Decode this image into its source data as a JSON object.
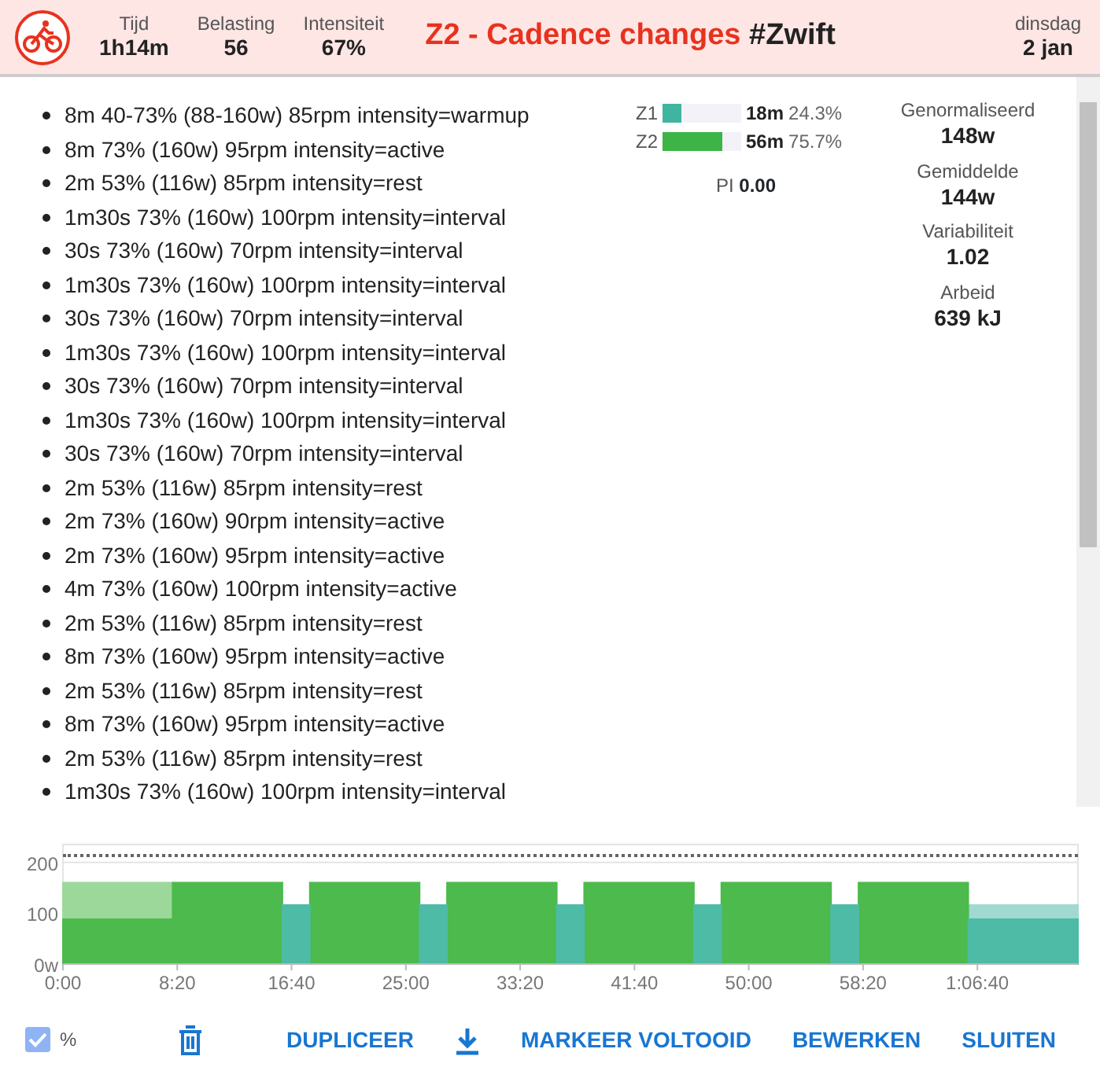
{
  "header": {
    "stats": [
      {
        "label": "Tijd",
        "value": "1h14m"
      },
      {
        "label": "Belasting",
        "value": "56"
      },
      {
        "label": "Intensiteit",
        "value": "67%"
      }
    ],
    "title": "Z2 - Cadence changes",
    "tag": "#Zwift",
    "day": "dinsdag",
    "date": "2 jan"
  },
  "steps": [
    "8m 40-73% (88-160w) 85rpm intensity=warmup",
    "8m 73% (160w) 95rpm intensity=active",
    "2m 53% (116w) 85rpm intensity=rest",
    "1m30s 73% (160w) 100rpm intensity=interval",
    "30s 73% (160w) 70rpm intensity=interval",
    "1m30s 73% (160w) 100rpm intensity=interval",
    "30s 73% (160w) 70rpm intensity=interval",
    "1m30s 73% (160w) 100rpm intensity=interval",
    "30s 73% (160w) 70rpm intensity=interval",
    "1m30s 73% (160w) 100rpm intensity=interval",
    "30s 73% (160w) 70rpm intensity=interval",
    "2m 53% (116w) 85rpm intensity=rest",
    "2m 73% (160w) 90rpm intensity=active",
    "2m 73% (160w) 95rpm intensity=active",
    "4m 73% (160w) 100rpm intensity=active",
    "2m 53% (116w) 85rpm intensity=rest",
    "8m 73% (160w) 95rpm intensity=active",
    "2m 53% (116w) 85rpm intensity=rest",
    "8m 73% (160w) 95rpm intensity=active",
    "2m 53% (116w) 85rpm intensity=rest",
    "1m30s 73% (160w) 100rpm intensity=interval"
  ],
  "zones": [
    {
      "name": "Z1",
      "color": "#3fb5a0",
      "level": 0.243,
      "time": "18m",
      "percent": "24.3%"
    },
    {
      "name": "Z2",
      "color": "#3cb446",
      "level": 0.757,
      "time": "56m",
      "percent": "75.7%"
    }
  ],
  "pi": {
    "label": "PI",
    "value": "0.00"
  },
  "metrics": [
    {
      "label": "Genormaliseerd",
      "value": "148w"
    },
    {
      "label": "Gemiddelde",
      "value": "144w"
    },
    {
      "label": "Variabiliteit",
      "value": "1.02"
    },
    {
      "label": "Arbeid",
      "value": "639 kJ"
    }
  ],
  "chart_data": {
    "type": "area",
    "x": [
      0,
      480,
      480,
      960,
      960,
      1080,
      1080,
      1560,
      1560,
      1680,
      1680,
      2160,
      2160,
      2280,
      2280,
      2760,
      2760,
      2880,
      2880,
      3360,
      3360,
      3480,
      3480,
      3960,
      3960,
      4440
    ],
    "xlim": [
      0,
      4440
    ],
    "ylim": [
      0,
      235
    ],
    "xticks": [
      {
        "value": 0,
        "label": "0:00"
      },
      {
        "value": 500,
        "label": "8:20"
      },
      {
        "value": 1000,
        "label": "16:40"
      },
      {
        "value": 1500,
        "label": "25:00"
      },
      {
        "value": 2000,
        "label": "33:20"
      },
      {
        "value": 2500,
        "label": "41:40"
      },
      {
        "value": 3000,
        "label": "50:00"
      },
      {
        "value": 3500,
        "label": "58:20"
      },
      {
        "value": 4000,
        "label": "1:06:40"
      }
    ],
    "yticks": [
      {
        "value": 0,
        "label": "0w"
      },
      {
        "value": 100,
        "label": "100"
      },
      {
        "value": 200,
        "label": "200"
      }
    ],
    "series": [
      {
        "color": "#9cd89a",
        "values": [
          160,
          160,
          null,
          null,
          null,
          null,
          null,
          null,
          null,
          null,
          null,
          null,
          null,
          null,
          null,
          null,
          null,
          null,
          null,
          null,
          null,
          null,
          null,
          null,
          null,
          null
        ]
      },
      {
        "color": "#9fd9cf",
        "values": [
          null,
          null,
          null,
          null,
          null,
          null,
          null,
          null,
          null,
          null,
          null,
          null,
          null,
          null,
          null,
          null,
          null,
          null,
          null,
          null,
          null,
          null,
          null,
          null,
          116,
          116
        ]
      },
      {
        "color": "#4cba4c",
        "values": [
          88,
          88,
          160,
          160,
          null,
          null,
          160,
          160,
          null,
          null,
          160,
          160,
          null,
          null,
          160,
          160,
          null,
          null,
          160,
          160,
          null,
          null,
          160,
          160,
          null,
          null
        ]
      },
      {
        "color": "#4dbba6",
        "values": [
          null,
          null,
          null,
          null,
          116,
          116,
          null,
          null,
          116,
          116,
          null,
          null,
          116,
          116,
          null,
          null,
          116,
          116,
          null,
          null,
          116,
          116,
          null,
          null,
          88,
          88
        ]
      }
    ]
  },
  "footer": {
    "checked": true,
    "check_label": "%",
    "buttons": [
      {
        "kind": "delete"
      },
      {
        "kind": "text",
        "label": "DUPLICEER"
      },
      {
        "kind": "download"
      },
      {
        "kind": "text",
        "label": "MARKEER VOLTOOID"
      },
      {
        "kind": "text",
        "label": "BEWERKEN"
      },
      {
        "kind": "text",
        "label": "SLUITEN"
      }
    ]
  }
}
